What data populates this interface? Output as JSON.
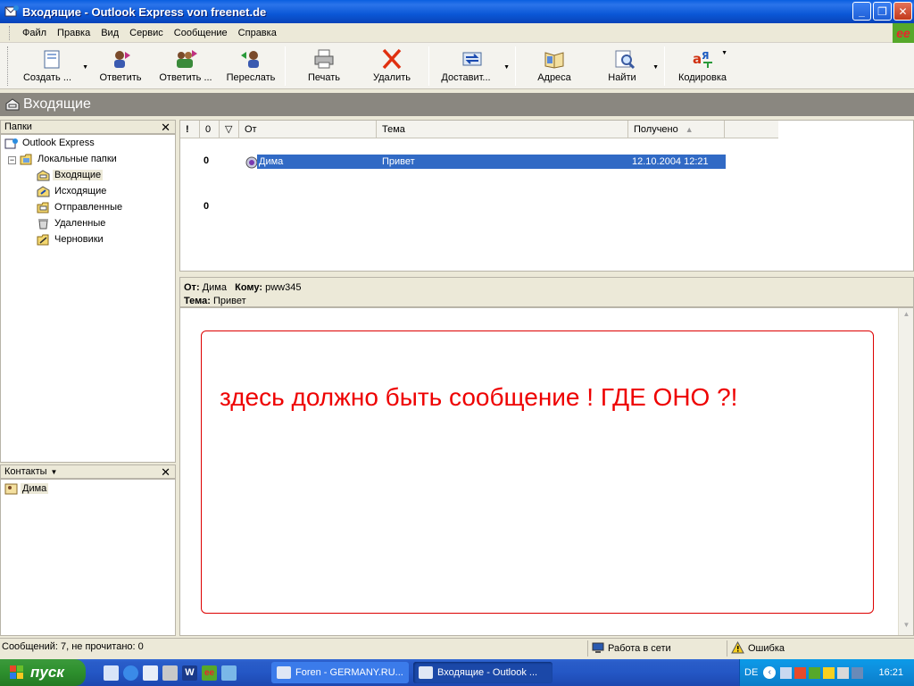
{
  "window": {
    "title": "Входящие - Outlook Express von freenet.de",
    "controls": {
      "minimize": "_",
      "maximize": "❐",
      "close": "✕"
    }
  },
  "menu": [
    "Файл",
    "Правка",
    "Вид",
    "Сервис",
    "Сообщение",
    "Справка"
  ],
  "brand_logo": "ee",
  "toolbar": {
    "create": "Создать ...",
    "reply": "Ответить",
    "reply_all": "Ответить ...",
    "forward": "Переслать",
    "print": "Печать",
    "delete": "Удалить",
    "deliver": "Доставит...",
    "addresses": "Адреса",
    "find": "Найти",
    "encoding": "Кодировка"
  },
  "folder_header": {
    "title": "Входящие"
  },
  "folders_pane": {
    "title": "Папки",
    "close": "✕",
    "root": "Outlook Express",
    "local": "Локальные папки",
    "items": [
      "Входящие",
      "Исходящие",
      "Отправленные",
      "Удаленные",
      "Черновики"
    ],
    "selected": "Входящие"
  },
  "contacts_pane": {
    "title": "Контакты",
    "close": "✕",
    "items": [
      "Дима"
    ]
  },
  "message_list": {
    "columns": {
      "priority": "!",
      "attachment": "0",
      "flag": "▽",
      "from": "От",
      "subject": "Тема",
      "received": "Получено"
    },
    "rows": [
      {
        "from": "Дима",
        "subject": "Привет",
        "received": "12.10.2004 12:21",
        "attach_mark": "0",
        "selected": true
      },
      {
        "from": "",
        "subject": "",
        "received": "",
        "attach_mark": "0",
        "selected": false
      }
    ]
  },
  "preview": {
    "from_label": "От:",
    "from": "Дима",
    "to_label": "Кому:",
    "to": "pww345",
    "subject_label": "Тема:",
    "subject": "Привет",
    "body": "здесь должно быть сообщение !  ГДЕ ОНО ?!"
  },
  "statusbar": {
    "messages": "Сообщений: 7, не прочитано: 0",
    "online": "Работа в сети",
    "error": "Ошибка"
  },
  "taskbar": {
    "start": "пуск",
    "tasks": [
      "Foren - GERMANY.RU...",
      "Входящие - Outlook ..."
    ],
    "language": "DE",
    "clock": "16:21"
  }
}
